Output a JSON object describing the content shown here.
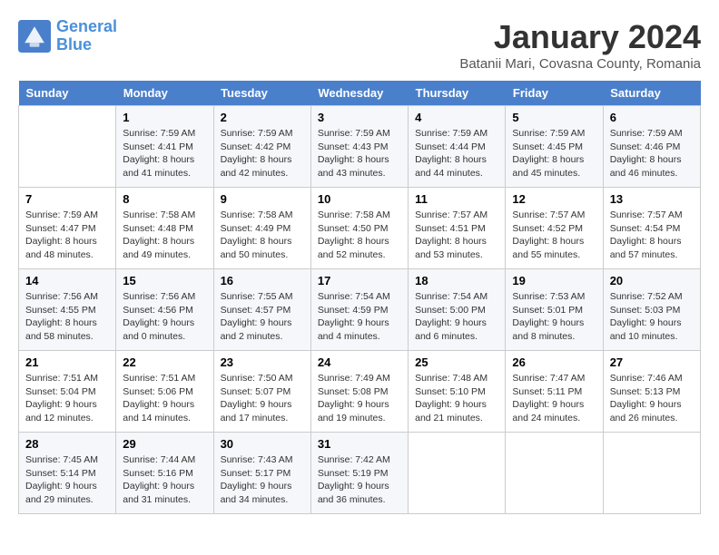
{
  "logo": {
    "line1": "General",
    "line2": "Blue"
  },
  "title": "January 2024",
  "subtitle": "Batanii Mari, Covasna County, Romania",
  "days_of_week": [
    "Sunday",
    "Monday",
    "Tuesday",
    "Wednesday",
    "Thursday",
    "Friday",
    "Saturday"
  ],
  "weeks": [
    [
      {
        "day": "",
        "sunrise": "",
        "sunset": "",
        "daylight": ""
      },
      {
        "day": "1",
        "sunrise": "Sunrise: 7:59 AM",
        "sunset": "Sunset: 4:41 PM",
        "daylight": "Daylight: 8 hours and 41 minutes."
      },
      {
        "day": "2",
        "sunrise": "Sunrise: 7:59 AM",
        "sunset": "Sunset: 4:42 PM",
        "daylight": "Daylight: 8 hours and 42 minutes."
      },
      {
        "day": "3",
        "sunrise": "Sunrise: 7:59 AM",
        "sunset": "Sunset: 4:43 PM",
        "daylight": "Daylight: 8 hours and 43 minutes."
      },
      {
        "day": "4",
        "sunrise": "Sunrise: 7:59 AM",
        "sunset": "Sunset: 4:44 PM",
        "daylight": "Daylight: 8 hours and 44 minutes."
      },
      {
        "day": "5",
        "sunrise": "Sunrise: 7:59 AM",
        "sunset": "Sunset: 4:45 PM",
        "daylight": "Daylight: 8 hours and 45 minutes."
      },
      {
        "day": "6",
        "sunrise": "Sunrise: 7:59 AM",
        "sunset": "Sunset: 4:46 PM",
        "daylight": "Daylight: 8 hours and 46 minutes."
      }
    ],
    [
      {
        "day": "7",
        "sunrise": "Sunrise: 7:59 AM",
        "sunset": "Sunset: 4:47 PM",
        "daylight": "Daylight: 8 hours and 48 minutes."
      },
      {
        "day": "8",
        "sunrise": "Sunrise: 7:58 AM",
        "sunset": "Sunset: 4:48 PM",
        "daylight": "Daylight: 8 hours and 49 minutes."
      },
      {
        "day": "9",
        "sunrise": "Sunrise: 7:58 AM",
        "sunset": "Sunset: 4:49 PM",
        "daylight": "Daylight: 8 hours and 50 minutes."
      },
      {
        "day": "10",
        "sunrise": "Sunrise: 7:58 AM",
        "sunset": "Sunset: 4:50 PM",
        "daylight": "Daylight: 8 hours and 52 minutes."
      },
      {
        "day": "11",
        "sunrise": "Sunrise: 7:57 AM",
        "sunset": "Sunset: 4:51 PM",
        "daylight": "Daylight: 8 hours and 53 minutes."
      },
      {
        "day": "12",
        "sunrise": "Sunrise: 7:57 AM",
        "sunset": "Sunset: 4:52 PM",
        "daylight": "Daylight: 8 hours and 55 minutes."
      },
      {
        "day": "13",
        "sunrise": "Sunrise: 7:57 AM",
        "sunset": "Sunset: 4:54 PM",
        "daylight": "Daylight: 8 hours and 57 minutes."
      }
    ],
    [
      {
        "day": "14",
        "sunrise": "Sunrise: 7:56 AM",
        "sunset": "Sunset: 4:55 PM",
        "daylight": "Daylight: 8 hours and 58 minutes."
      },
      {
        "day": "15",
        "sunrise": "Sunrise: 7:56 AM",
        "sunset": "Sunset: 4:56 PM",
        "daylight": "Daylight: 9 hours and 0 minutes."
      },
      {
        "day": "16",
        "sunrise": "Sunrise: 7:55 AM",
        "sunset": "Sunset: 4:57 PM",
        "daylight": "Daylight: 9 hours and 2 minutes."
      },
      {
        "day": "17",
        "sunrise": "Sunrise: 7:54 AM",
        "sunset": "Sunset: 4:59 PM",
        "daylight": "Daylight: 9 hours and 4 minutes."
      },
      {
        "day": "18",
        "sunrise": "Sunrise: 7:54 AM",
        "sunset": "Sunset: 5:00 PM",
        "daylight": "Daylight: 9 hours and 6 minutes."
      },
      {
        "day": "19",
        "sunrise": "Sunrise: 7:53 AM",
        "sunset": "Sunset: 5:01 PM",
        "daylight": "Daylight: 9 hours and 8 minutes."
      },
      {
        "day": "20",
        "sunrise": "Sunrise: 7:52 AM",
        "sunset": "Sunset: 5:03 PM",
        "daylight": "Daylight: 9 hours and 10 minutes."
      }
    ],
    [
      {
        "day": "21",
        "sunrise": "Sunrise: 7:51 AM",
        "sunset": "Sunset: 5:04 PM",
        "daylight": "Daylight: 9 hours and 12 minutes."
      },
      {
        "day": "22",
        "sunrise": "Sunrise: 7:51 AM",
        "sunset": "Sunset: 5:06 PM",
        "daylight": "Daylight: 9 hours and 14 minutes."
      },
      {
        "day": "23",
        "sunrise": "Sunrise: 7:50 AM",
        "sunset": "Sunset: 5:07 PM",
        "daylight": "Daylight: 9 hours and 17 minutes."
      },
      {
        "day": "24",
        "sunrise": "Sunrise: 7:49 AM",
        "sunset": "Sunset: 5:08 PM",
        "daylight": "Daylight: 9 hours and 19 minutes."
      },
      {
        "day": "25",
        "sunrise": "Sunrise: 7:48 AM",
        "sunset": "Sunset: 5:10 PM",
        "daylight": "Daylight: 9 hours and 21 minutes."
      },
      {
        "day": "26",
        "sunrise": "Sunrise: 7:47 AM",
        "sunset": "Sunset: 5:11 PM",
        "daylight": "Daylight: 9 hours and 24 minutes."
      },
      {
        "day": "27",
        "sunrise": "Sunrise: 7:46 AM",
        "sunset": "Sunset: 5:13 PM",
        "daylight": "Daylight: 9 hours and 26 minutes."
      }
    ],
    [
      {
        "day": "28",
        "sunrise": "Sunrise: 7:45 AM",
        "sunset": "Sunset: 5:14 PM",
        "daylight": "Daylight: 9 hours and 29 minutes."
      },
      {
        "day": "29",
        "sunrise": "Sunrise: 7:44 AM",
        "sunset": "Sunset: 5:16 PM",
        "daylight": "Daylight: 9 hours and 31 minutes."
      },
      {
        "day": "30",
        "sunrise": "Sunrise: 7:43 AM",
        "sunset": "Sunset: 5:17 PM",
        "daylight": "Daylight: 9 hours and 34 minutes."
      },
      {
        "day": "31",
        "sunrise": "Sunrise: 7:42 AM",
        "sunset": "Sunset: 5:19 PM",
        "daylight": "Daylight: 9 hours and 36 minutes."
      },
      {
        "day": "",
        "sunrise": "",
        "sunset": "",
        "daylight": ""
      },
      {
        "day": "",
        "sunrise": "",
        "sunset": "",
        "daylight": ""
      },
      {
        "day": "",
        "sunrise": "",
        "sunset": "",
        "daylight": ""
      }
    ]
  ]
}
